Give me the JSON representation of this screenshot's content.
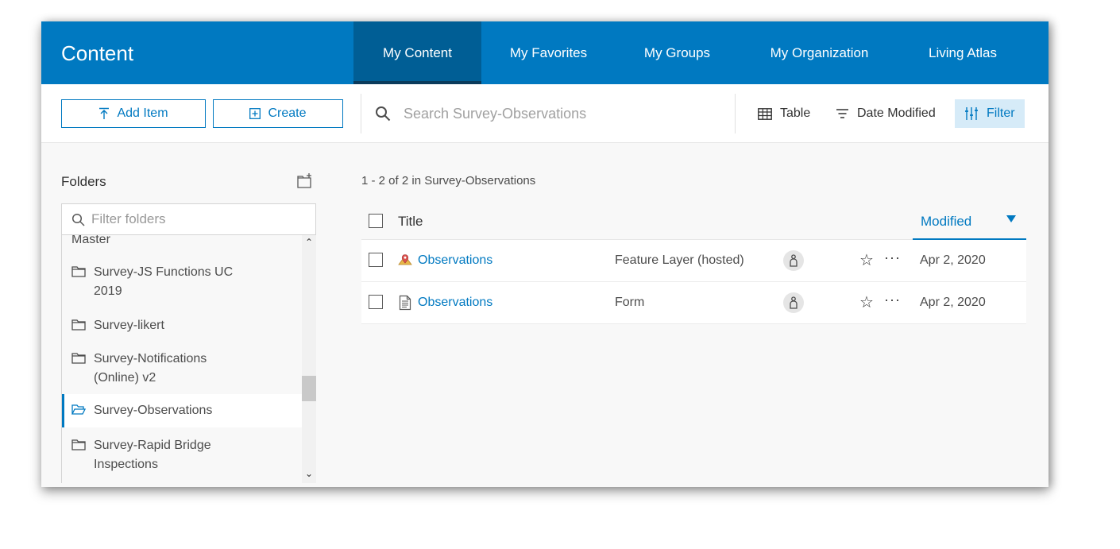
{
  "header": {
    "title": "Content",
    "tabs": [
      {
        "label": "My Content",
        "active": true
      },
      {
        "label": "My Favorites",
        "active": false
      },
      {
        "label": "My Groups",
        "active": false
      },
      {
        "label": "My Organization",
        "active": false
      },
      {
        "label": "Living Atlas",
        "active": false
      }
    ]
  },
  "toolbar": {
    "add_item_label": "Add Item",
    "create_label": "Create",
    "search_placeholder": "Search Survey-Observations",
    "table_label": "Table",
    "sort_label": "Date Modified",
    "filter_label": "Filter"
  },
  "sidebar": {
    "heading": "Folders",
    "filter_placeholder": "Filter folders",
    "folders": [
      {
        "label": "Master",
        "selected": false
      },
      {
        "label": "Survey-JS Functions UC 2019",
        "selected": false
      },
      {
        "label": "Survey-likert",
        "selected": false
      },
      {
        "label": "Survey-Notifications (Online) v2",
        "selected": false
      },
      {
        "label": "Survey-Observations",
        "selected": true
      },
      {
        "label": "Survey-Rapid Bridge Inspections",
        "selected": false
      }
    ]
  },
  "main": {
    "result_count": "1 - 2 of 2 in Survey-Observations",
    "columns": {
      "title": "Title",
      "modified": "Modified"
    },
    "rows": [
      {
        "title": "Observations",
        "type": "Feature Layer (hosted)",
        "modified": "Apr 2, 2020",
        "icon": "feature-layer-icon"
      },
      {
        "title": "Observations",
        "type": "Form",
        "modified": "Apr 2, 2020",
        "icon": "form-icon"
      }
    ]
  },
  "colors": {
    "brand": "#0079c1",
    "brand_dark": "#005e95"
  }
}
